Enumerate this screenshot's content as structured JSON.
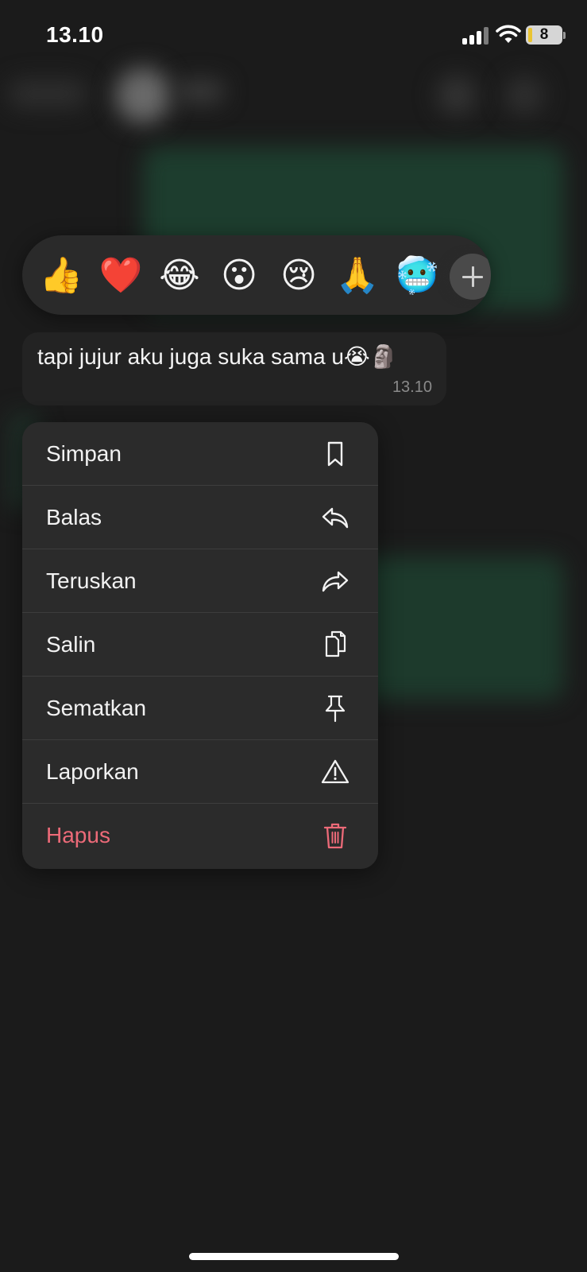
{
  "status_bar": {
    "time": "13.10",
    "battery_level": "8",
    "signal_icon": "cellular-signal-icon",
    "wifi_icon": "wifi-icon",
    "battery_icon": "battery-icon"
  },
  "reactions": [
    {
      "emoji": "👍",
      "name": "thumbs-up"
    },
    {
      "emoji": "❤️",
      "name": "red-heart"
    },
    {
      "emoji": "😂",
      "name": "tears-of-joy"
    },
    {
      "emoji": "😮",
      "name": "surprised"
    },
    {
      "emoji": "😢",
      "name": "crying"
    },
    {
      "emoji": "🙏",
      "name": "folded-hands"
    },
    {
      "emoji": "🥶",
      "name": "cold-face"
    }
  ],
  "add_reaction_icon": "plus-icon",
  "message": {
    "text": "tapi jujur aku juga suka sama u😭🗿",
    "time": "13.10"
  },
  "menu": {
    "items": [
      {
        "label": "Simpan",
        "icon": "bookmark-icon"
      },
      {
        "label": "Balas",
        "icon": "reply-icon"
      },
      {
        "label": "Teruskan",
        "icon": "forward-icon"
      },
      {
        "label": "Salin",
        "icon": "copy-icon"
      },
      {
        "label": "Sematkan",
        "icon": "pin-icon"
      },
      {
        "label": "Laporkan",
        "icon": "warning-icon"
      },
      {
        "label": "Hapus",
        "icon": "trash-icon",
        "destructive": true
      }
    ]
  },
  "colors": {
    "background": "#1b1b1b",
    "menu_background": "#2b2b2b",
    "destructive": "#ec6a78",
    "battery_accent": "#e9c432"
  }
}
